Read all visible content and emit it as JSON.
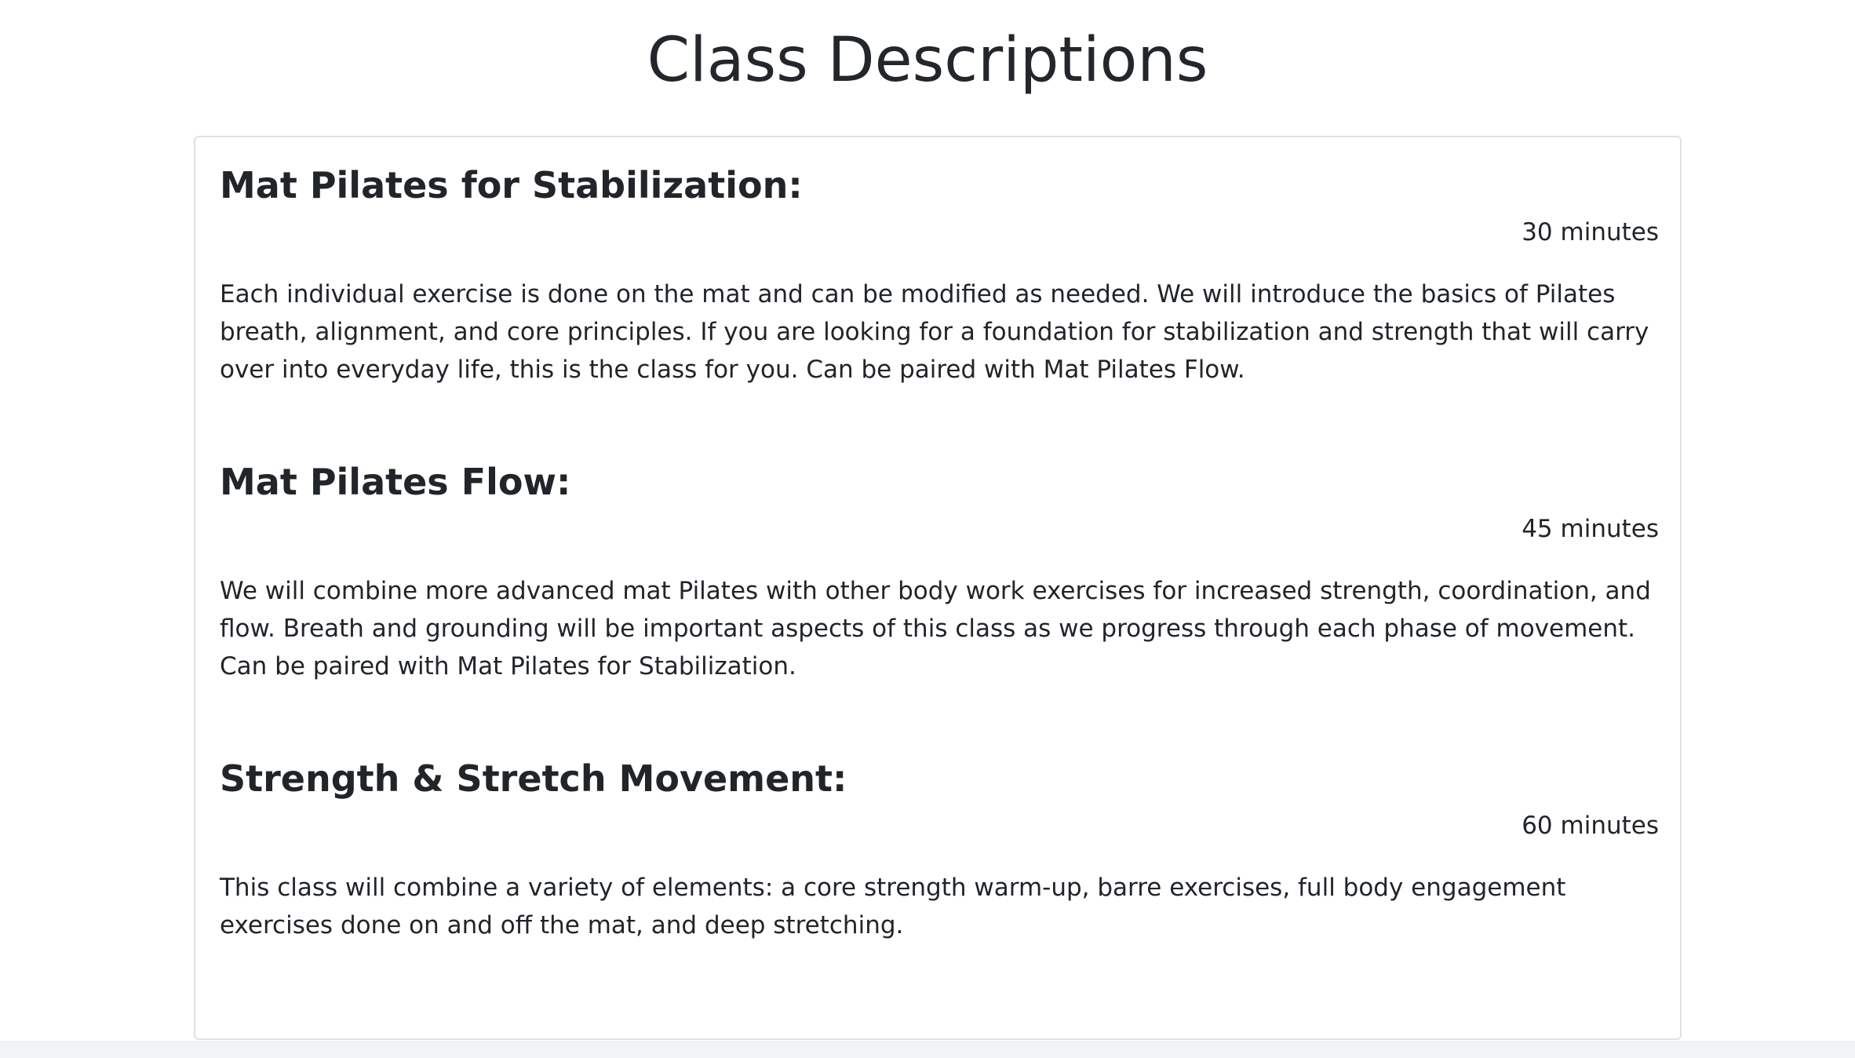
{
  "page": {
    "title": "Class Descriptions"
  },
  "classes": [
    {
      "title": "Mat Pilates for Stabilization:",
      "duration": "30 minutes",
      "description": "Each individual exercise is done on the mat and can be modified as needed. We will introduce the basics of Pilates breath, alignment, and core principles. If you are looking for a foundation for stabilization and strength that will carry over into everyday life, this is the class for you. Can be paired with Mat Pilates Flow."
    },
    {
      "title": "Mat Pilates Flow:",
      "duration": "45 minutes",
      "description": "We will combine more advanced mat Pilates with other body work exercises for increased strength, coordination, and flow. Breath and grounding will be important aspects of this class as we progress through each phase of movement. Can be paired with Mat Pilates for Stabilization."
    },
    {
      "title": "Strength & Stretch Movement:",
      "duration": "60 minutes",
      "description": "This class will combine a variety of elements: a core strength warm-up, barre exercises, full body engagement exercises done on and off the mat, and deep stretching."
    }
  ]
}
